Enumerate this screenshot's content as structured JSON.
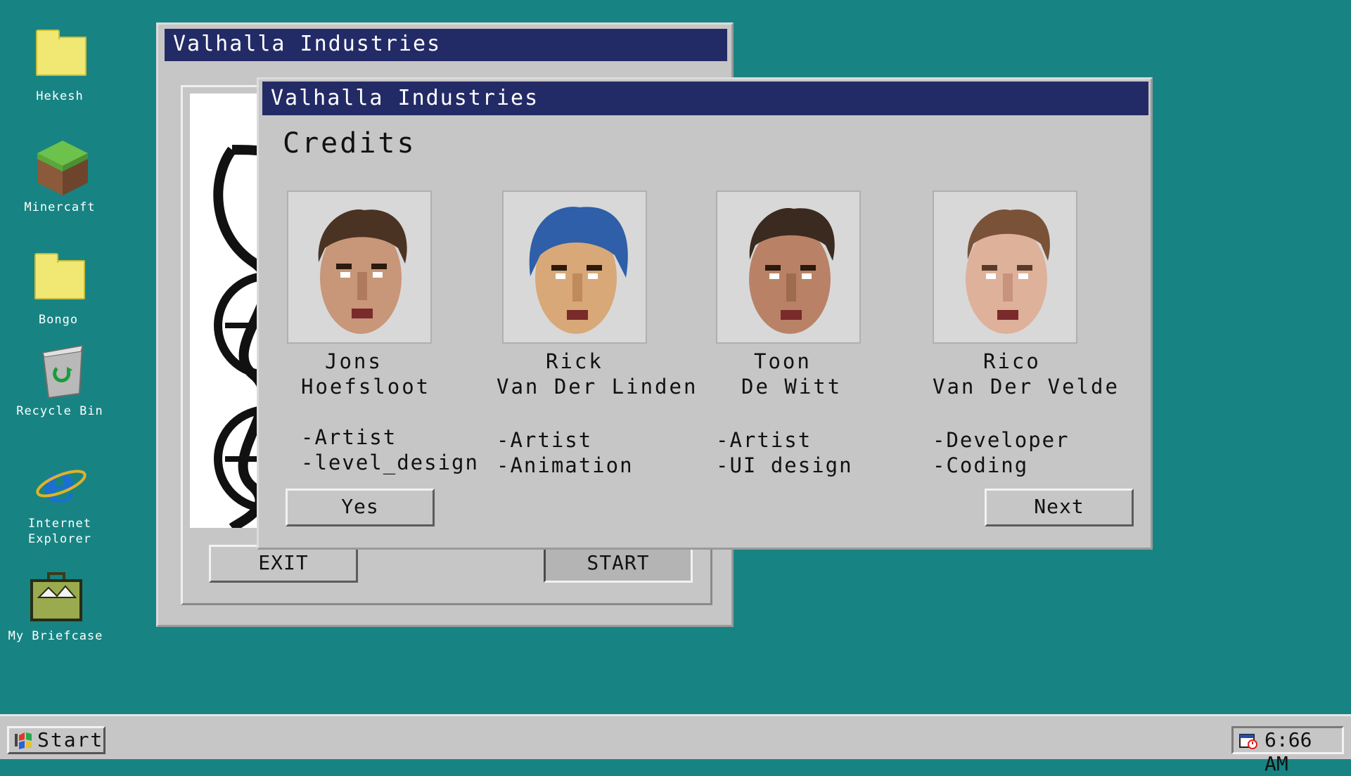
{
  "desktop_icons": [
    {
      "label": "Hekesh",
      "icon": "folder-icon"
    },
    {
      "label": "Minercaft",
      "icon": "grass-block-icon"
    },
    {
      "label": "Bongo",
      "icon": "folder-icon"
    },
    {
      "label": "Recycle Bin",
      "icon": "recycle-bin-icon"
    },
    {
      "label": "Internet Explorer",
      "icon": "internet-explorer-icon"
    },
    {
      "label": "My Briefcase",
      "icon": "briefcase-icon"
    }
  ],
  "back_window": {
    "title": "Valhalla Industries",
    "exit_label": "EXIT",
    "start_label": "START"
  },
  "credits_window": {
    "title": "Valhalla Industries",
    "heading": "Credits",
    "members": [
      {
        "first": "Jons",
        "last": "Hoefsloot",
        "role1": "-Artist",
        "role2": "-level_design",
        "hair": "#4a3323"
      },
      {
        "first": "Rick",
        "last": "Van Der Linden",
        "role1": "-Artist",
        "role2": "-Animation",
        "hair": "#2e5fa8"
      },
      {
        "first": "Toon",
        "last": "De Witt",
        "role1": "-Artist",
        "role2": "-UI design",
        "hair": "#3b2a1f"
      },
      {
        "first": "Rico",
        "last": "Van Der Velde",
        "role1": "-Developer",
        "role2": "-Coding",
        "hair": "#7a5238"
      }
    ],
    "yes_label": "Yes",
    "next_label": "Next"
  },
  "taskbar": {
    "start_label": "Start",
    "clock": "6:66 AM"
  },
  "colors": {
    "desktop": "#178483",
    "titlebar": "#232b66",
    "window": "#c6c6c6"
  }
}
